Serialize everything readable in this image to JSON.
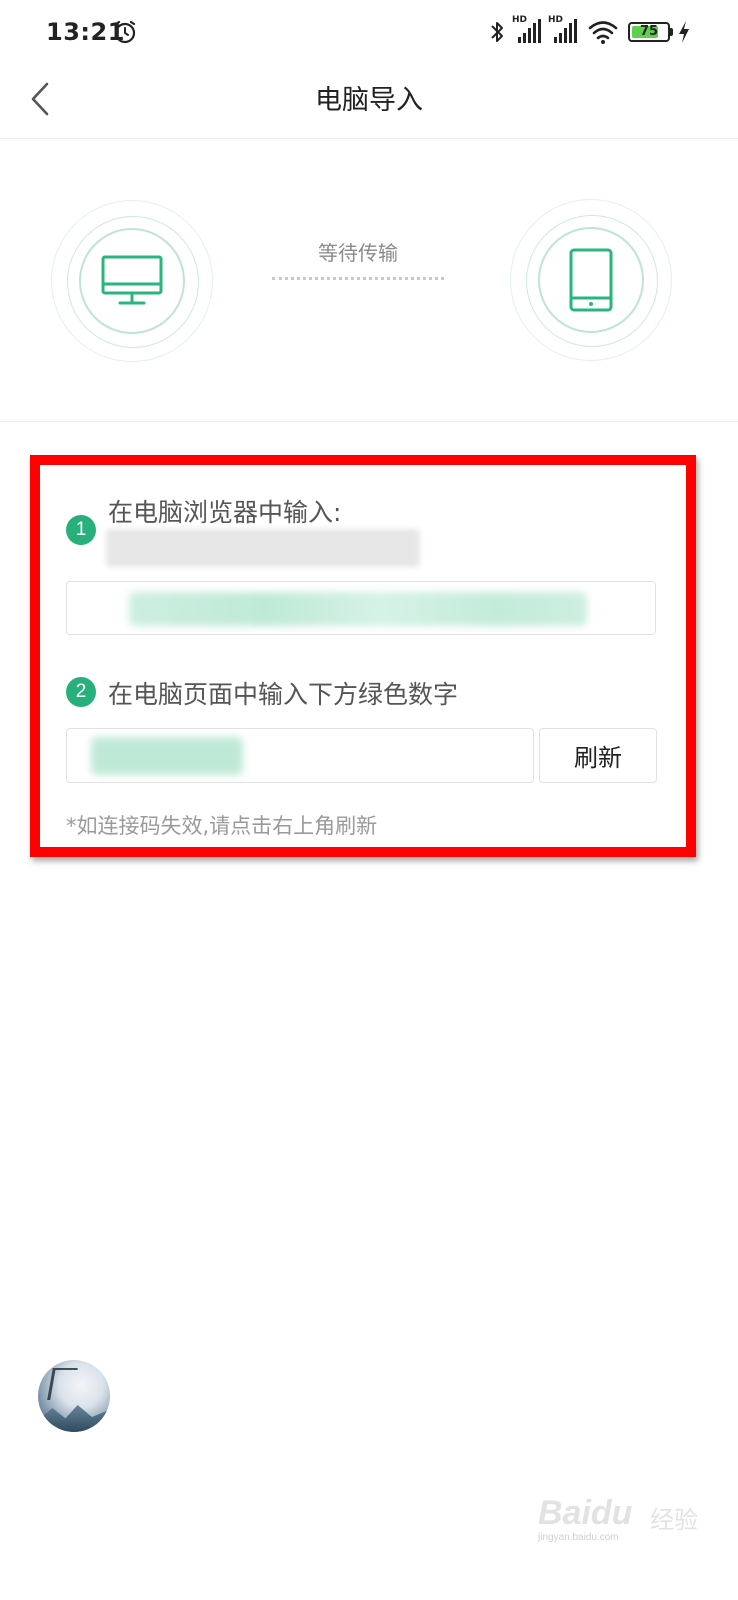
{
  "status_bar": {
    "time": "13:21",
    "hd_label_1": "HD",
    "hd_label_2": "HD",
    "battery_level": "75",
    "battery_fraction": 0.75
  },
  "header": {
    "title": "电脑导入"
  },
  "transfer": {
    "status": "等待传输",
    "left_icon": "monitor-icon",
    "right_icon": "tablet-icon"
  },
  "instructions": {
    "step1_number": "1",
    "step1_text": "在电脑浏览器中输入:",
    "step2_number": "2",
    "step2_text": "在电脑页面中输入下方绿色数字",
    "refresh_label": "刷新",
    "tip": "*如连接码失效,请点击右上角刷新"
  },
  "watermark": {
    "logo": "Baidu",
    "logo_cn": "经验",
    "url": "jingyan.baidu.com"
  },
  "colors": {
    "accent_green": "#27b07c",
    "highlight_border": "#ff0000",
    "icon_green": "#2ab57d"
  }
}
